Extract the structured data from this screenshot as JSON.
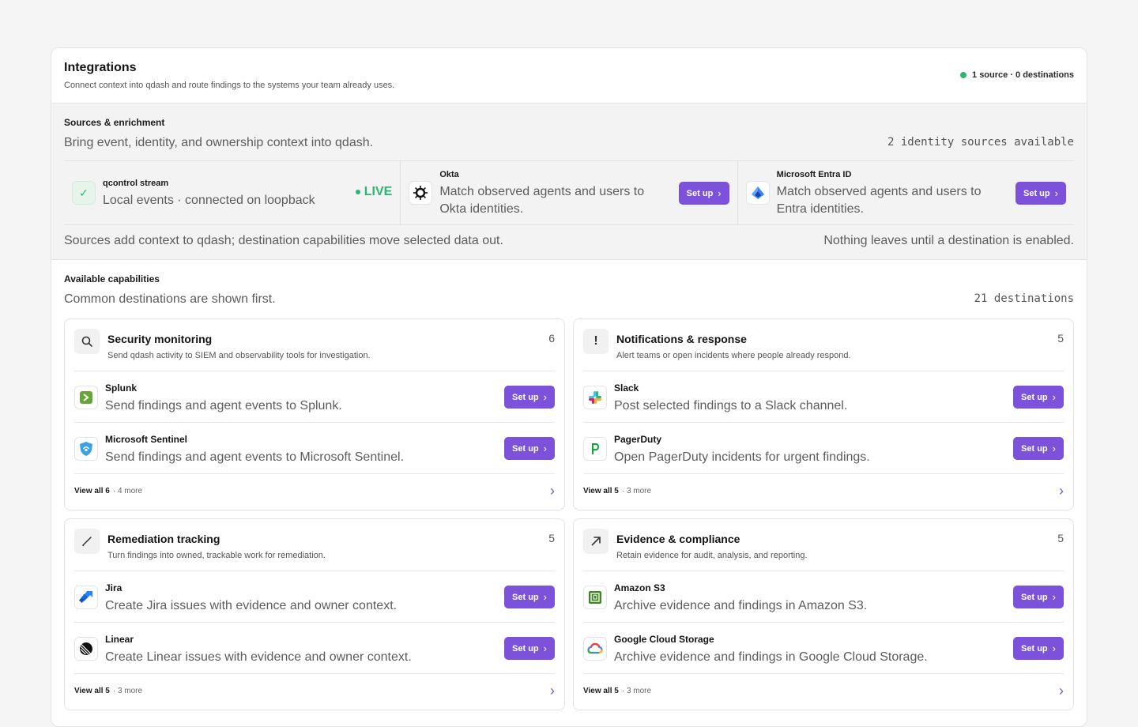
{
  "header": {
    "title": "Integrations",
    "subtitle": "Connect context into qdash and route findings to the systems your team already uses.",
    "status": "1 source · 0 destinations"
  },
  "sources": {
    "title": "Sources & enrichment",
    "subtitle": "Bring event, identity, and ownership context into qdash.",
    "count": "2 identity sources available",
    "items": [
      {
        "name": "qcontrol stream",
        "desc": "Local events · connected on loopback",
        "badge": "LIVE"
      },
      {
        "name": "Okta",
        "desc": "Match observed agents and users to Okta identities.",
        "button": "Set up"
      },
      {
        "name": "Microsoft Entra ID",
        "desc": "Match observed agents and users to Entra identities.",
        "button": "Set up"
      }
    ],
    "footer_left": "Sources add context to qdash; destination capabilities move selected data out.",
    "footer_right": "Nothing leaves until a destination is enabled."
  },
  "capabilities": {
    "title": "Available capabilities",
    "subtitle": "Common destinations are shown first.",
    "count": "21 destinations",
    "categories": [
      {
        "title": "Security monitoring",
        "subtitle": "Send qdash activity to SIEM and observability tools for investigation.",
        "count": "6",
        "icon": "search-icon",
        "items": [
          {
            "name": "Splunk",
            "desc": "Send findings and agent events to Splunk.",
            "button": "Set up"
          },
          {
            "name": "Microsoft Sentinel",
            "desc": "Send findings and agent events to Microsoft Sentinel.",
            "button": "Set up"
          }
        ],
        "view_all": "View all 6",
        "more": "· 4 more"
      },
      {
        "title": "Notifications & response",
        "subtitle": "Alert teams or open incidents where people already respond.",
        "count": "5",
        "icon": "exclamation-icon",
        "items": [
          {
            "name": "Slack",
            "desc": "Post selected findings to a Slack channel.",
            "button": "Set up"
          },
          {
            "name": "PagerDuty",
            "desc": "Open PagerDuty incidents for urgent findings.",
            "button": "Set up"
          }
        ],
        "view_all": "View all 5",
        "more": "· 3 more"
      },
      {
        "title": "Remediation tracking",
        "subtitle": "Turn findings into owned, trackable work for remediation.",
        "count": "5",
        "icon": "pencil-icon",
        "items": [
          {
            "name": "Jira",
            "desc": "Create Jira issues with evidence and owner context.",
            "button": "Set up"
          },
          {
            "name": "Linear",
            "desc": "Create Linear issues with evidence and owner context.",
            "button": "Set up"
          }
        ],
        "view_all": "View all 5",
        "more": "· 3 more"
      },
      {
        "title": "Evidence & compliance",
        "subtitle": "Retain evidence for audit, analysis, and reporting.",
        "count": "5",
        "icon": "arrow-up-right-icon",
        "items": [
          {
            "name": "Amazon S3",
            "desc": "Archive evidence and findings in Amazon S3.",
            "button": "Set up"
          },
          {
            "name": "Google Cloud Storage",
            "desc": "Archive evidence and findings in Google Cloud Storage.",
            "button": "Set up"
          }
        ],
        "view_all": "View all 5",
        "more": "· 3 more"
      }
    ]
  },
  "colors": {
    "accent": "#7b52d9",
    "live": "#2bb673"
  }
}
